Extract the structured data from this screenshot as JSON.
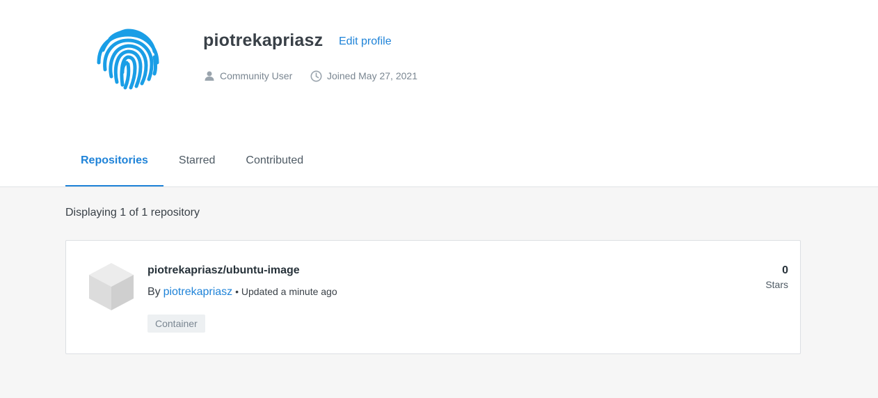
{
  "profile": {
    "username": "piotrekapriasz",
    "edit_label": "Edit profile",
    "role": "Community User",
    "joined": "Joined May 27, 2021",
    "avatar_icon": "fingerprint-icon",
    "role_icon": "person-icon",
    "joined_icon": "clock-icon"
  },
  "tabs": [
    {
      "label": "Repositories",
      "active": true
    },
    {
      "label": "Starred",
      "active": false
    },
    {
      "label": "Contributed",
      "active": false
    }
  ],
  "listing": {
    "summary": "Displaying 1 of 1 repository"
  },
  "repositories": [
    {
      "name": "piotrekapriasz/ubuntu-image",
      "by_label": "By",
      "owner": "piotrekapriasz",
      "updated": "• Updated a minute ago",
      "tag": "Container",
      "stars": "0",
      "stars_label": "Stars",
      "icon": "cube-icon"
    }
  ],
  "colors": {
    "accent": "#1f83d8",
    "avatar": "#1a9ee6",
    "page_bg": "#f6f6f6",
    "text": "#27323a"
  }
}
